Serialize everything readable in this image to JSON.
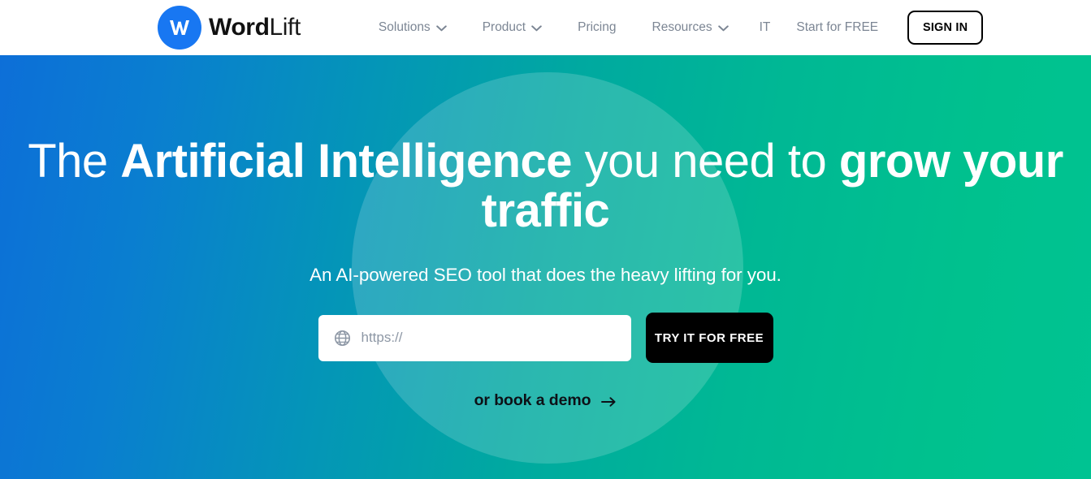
{
  "header": {
    "brand": {
      "mark_icon": "wordlift-w-logo-icon",
      "name_strong": "Word",
      "name_light": "Lift",
      "mark_color": "#1877f2"
    },
    "nav": [
      {
        "label": "Solutions",
        "has_dropdown": true,
        "icon": "chevron-down-icon"
      },
      {
        "label": "Product",
        "has_dropdown": true,
        "icon": "chevron-down-icon"
      },
      {
        "label": "Pricing",
        "has_dropdown": false,
        "icon": ""
      },
      {
        "label": "Resources",
        "has_dropdown": true,
        "icon": "chevron-down-icon"
      }
    ],
    "language": "IT",
    "start_free": "Start for FREE",
    "sign_in": "SIGN IN"
  },
  "hero": {
    "title": {
      "part1": "The ",
      "strong1": "Artificial Intelligence",
      "part2": " you need to ",
      "strong2": "grow your traffic"
    },
    "subtitle": "An AI-powered SEO tool that does the heavy lifting for you.",
    "url_input": {
      "placeholder": "https://",
      "value": "",
      "icon": "globe-icon"
    },
    "cta_button": "TRY IT FOR FREE",
    "demo_link": {
      "label": "or book a demo",
      "icon": "arrow-right-icon"
    },
    "colors": {
      "gradient_start": "#0d6fd8",
      "gradient_mid": "#00a9a0",
      "gradient_end": "#00c18e",
      "circle_overlay": "rgba(255,255,255,0.17)",
      "cta_background": "#000000",
      "text": "#ffffff"
    }
  }
}
